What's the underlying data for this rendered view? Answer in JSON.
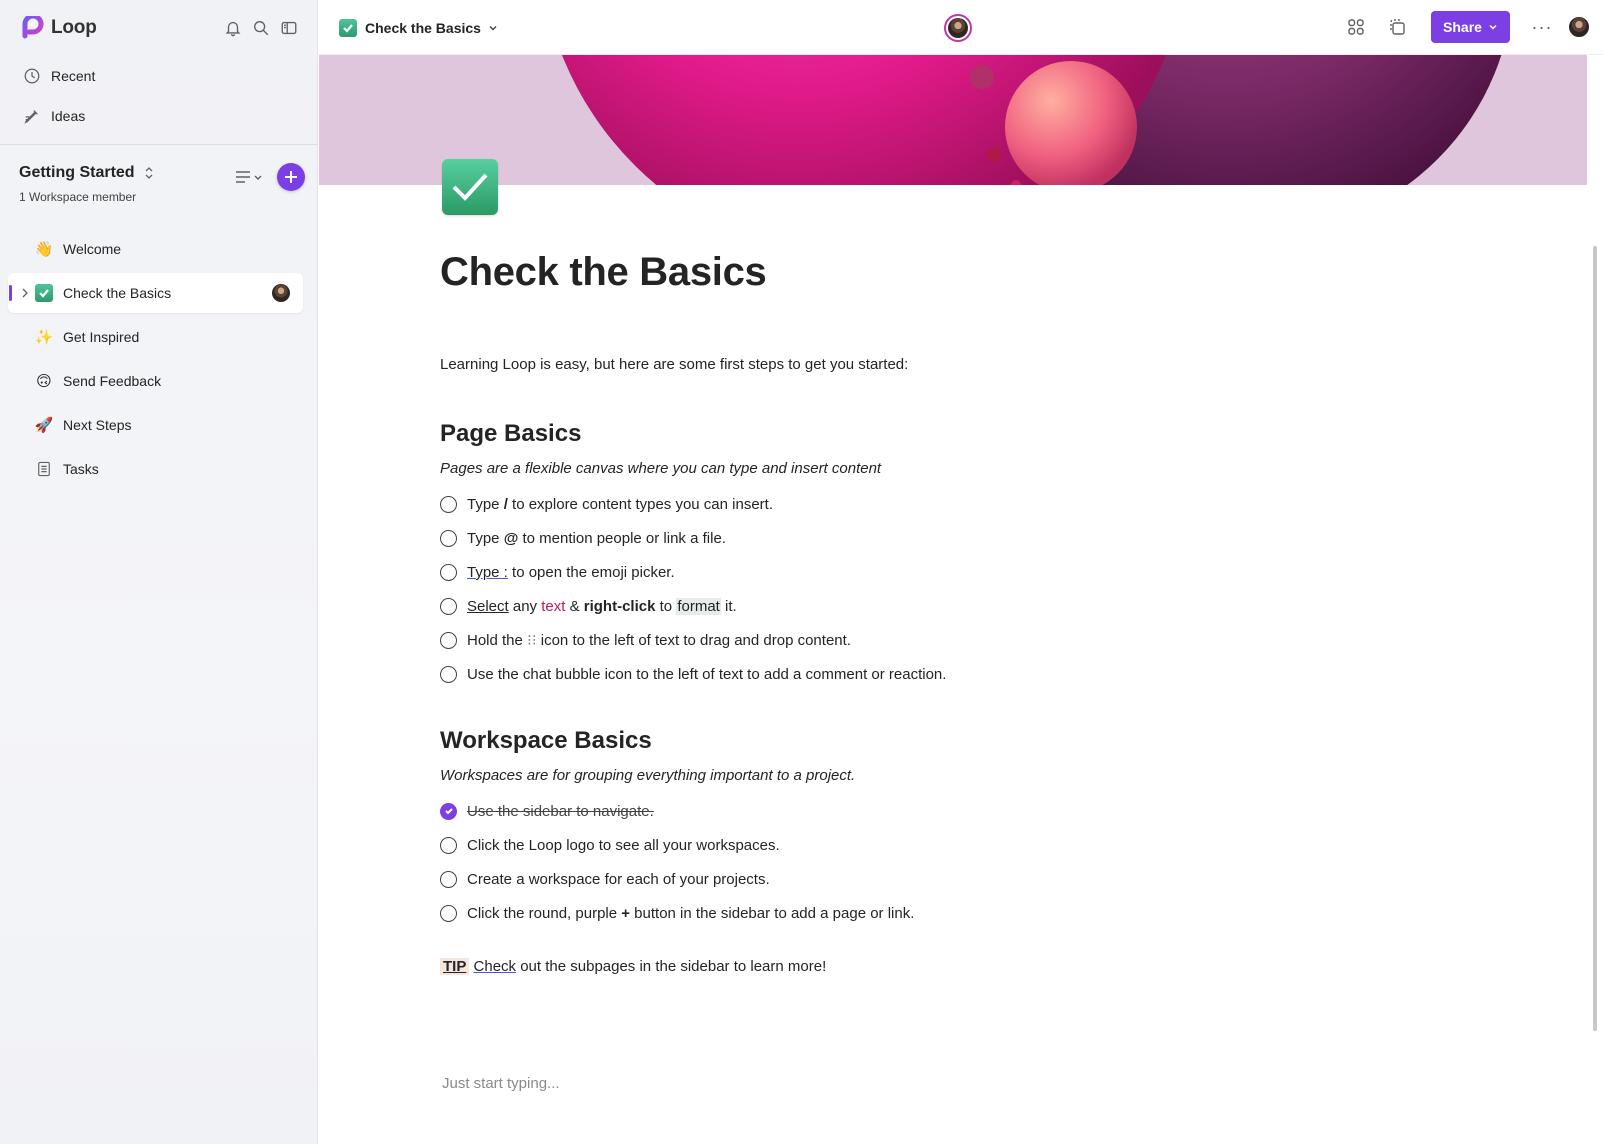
{
  "app": {
    "name": "Loop"
  },
  "sidebar": {
    "top_nav": [
      {
        "label": "Recent",
        "icon": "clock-icon"
      },
      {
        "label": "Ideas",
        "icon": "ideas-icon"
      }
    ],
    "workspace": {
      "title": "Getting Started",
      "subtitle": "1 Workspace member"
    },
    "pages": [
      {
        "label": "Welcome",
        "emoji": "👋"
      },
      {
        "label": "Check the Basics",
        "emoji": "check",
        "active": true
      },
      {
        "label": "Get Inspired",
        "emoji": "✨"
      },
      {
        "label": "Send Feedback",
        "emoji": "🙃"
      },
      {
        "label": "Next Steps",
        "emoji": "🚀"
      },
      {
        "label": "Tasks",
        "emoji": "tasks"
      }
    ]
  },
  "topbar": {
    "doc_title": "Check the Basics",
    "share_label": "Share",
    "more_label": "···"
  },
  "doc": {
    "title": "Check the Basics",
    "intro": "Learning Loop is easy, but here are some first steps to get you started:",
    "sections": [
      {
        "heading": "Page Basics",
        "subtitle": "Pages are a flexible canvas where you can type and insert content",
        "tasks": [
          {
            "parts": [
              "Type ",
              "/",
              " to explore content types you can insert."
            ],
            "done": false
          },
          {
            "parts": [
              "Type ",
              "@",
              " to mention people or link a file."
            ],
            "done": false
          },
          {
            "parts": [
              "Type :",
              " to open the emoji picker."
            ],
            "done": false
          },
          {
            "parts": [
              "Select",
              " any ",
              "text",
              " & ",
              "right-click",
              " to ",
              "format",
              " it."
            ],
            "done": false
          },
          {
            "parts": [
              "Hold the ",
              "⁝⁝",
              " icon to the left of text to drag and drop content."
            ],
            "done": false
          },
          {
            "parts": [
              "Use the chat bubble icon to the left of text to add a comment or reaction."
            ],
            "done": false
          }
        ]
      },
      {
        "heading": "Workspace Basics",
        "subtitle": "Workspaces are for grouping everything important to a project.",
        "tasks": [
          {
            "parts": [
              "Use the sidebar to navigate."
            ],
            "done": true
          },
          {
            "parts": [
              "Click the Loop logo to see all your workspaces."
            ],
            "done": false
          },
          {
            "parts": [
              "Create a workspace for each of your projects."
            ],
            "done": false
          },
          {
            "parts": [
              "Click the round, purple ",
              "+",
              " button in the sidebar to add a page or link."
            ],
            "done": false
          }
        ]
      }
    ],
    "tip": {
      "badge": "TIP",
      "link": "Check",
      "rest": " out the subpages in the sidebar to learn more!"
    },
    "placeholder": "Just start typing..."
  },
  "colors": {
    "accent": "#7b3fe4",
    "check_green": "#2e9b6e",
    "format_red": "#c2185b"
  }
}
